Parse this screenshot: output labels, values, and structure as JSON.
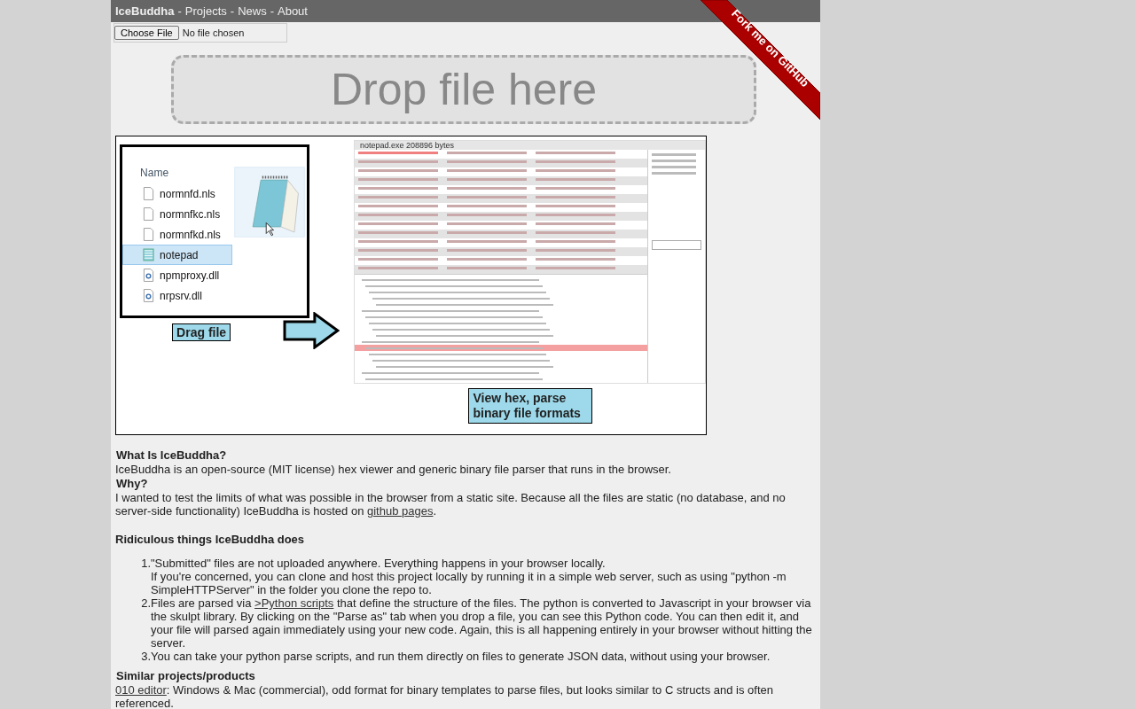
{
  "nav": {
    "brand": "IceBuddha",
    "links": [
      {
        "label": "Projects"
      },
      {
        "label": "News"
      },
      {
        "label": "About"
      }
    ],
    "separator": "-"
  },
  "file_input": {
    "button": "Choose File",
    "status": "No file chosen"
  },
  "drop_zone": {
    "label": "Drop file here"
  },
  "ribbon": {
    "label": "Fork me on GitHub"
  },
  "demo": {
    "explorer": {
      "header": "Name",
      "files": [
        {
          "name": "normnfd.nls",
          "kind": "doc",
          "selected": false
        },
        {
          "name": "normnfkc.nls",
          "kind": "doc",
          "selected": false
        },
        {
          "name": "normnfkd.nls",
          "kind": "doc",
          "selected": false
        },
        {
          "name": "notepad",
          "kind": "notepad",
          "selected": true
        },
        {
          "name": "npmproxy.dll",
          "kind": "dll",
          "selected": false
        },
        {
          "name": "nrpsrv.dll",
          "kind": "dll",
          "selected": false
        }
      ]
    },
    "drag_caption": "Drag file",
    "hex_title": "notepad.exe   208896 bytes",
    "hex_caption": "View hex, parse binary file formats"
  },
  "sections": [
    {
      "kind": "heading",
      "text": "What Is IceBuddha?"
    },
    {
      "kind": "para",
      "text": "IceBuddha is an open-source (MIT license) hex viewer and generic binary file parser that runs in the browser."
    },
    {
      "kind": "heading",
      "text": "Why?"
    },
    {
      "kind": "para",
      "text": "I wanted to test the limits of what was possible in the browser from a static site. Because all the files are static (no database, and no server-side functionality) IceBuddha is hosted on ",
      "link": "github pages",
      "after": "."
    },
    {
      "kind": "heading2",
      "text": "Ridiculous things IceBuddha does"
    },
    {
      "kind": "list",
      "items": [
        {
          "marker": "1.",
          "text": "\"Submitted\" files are not uploaded anywhere. Everything happens in your browser locally.",
          "extra": "If you're concerned, you can clone and host this project locally by running it in a simple web server, such as using \"python -m SimpleHTTPServer\" in the folder you clone the repo to."
        },
        {
          "marker": "2.",
          "text": "Files are parsed via ",
          "link": ">Python scripts",
          "after": " that define the structure of the files. The python is converted to Javascript in your browser via the skulpt library. By clicking on the \"Parse as\" tab when you drop a file, you can see this Python code. You can then edit it, and your file will parsed again immediately using your new code. Again, this is all happening entirely in your browser without hitting the server."
        },
        {
          "marker": "3.",
          "text": "You can take your python parse scripts, and run them directly on files to generate JSON data, without using your browser."
        }
      ]
    },
    {
      "kind": "heading",
      "text": "Similar projects/products"
    },
    {
      "kind": "para",
      "link": "010 editor",
      "after": ": Windows & Mac (commercial), odd format for binary templates to parse files, but looks similar to C structs and is often referenced."
    }
  ]
}
